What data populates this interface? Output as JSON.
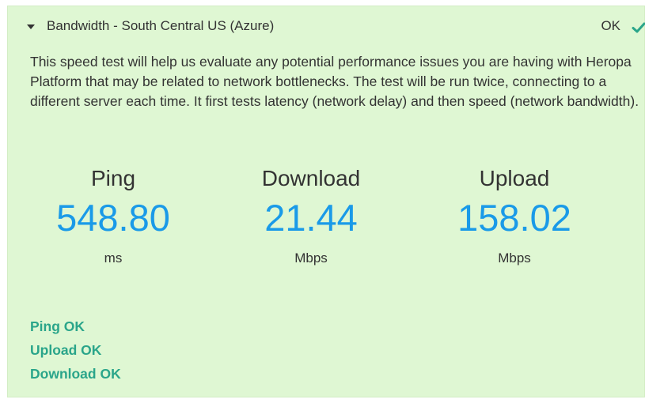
{
  "panel": {
    "title": "Bandwidth - South Central US (Azure)",
    "status": "OK",
    "caret_icon": "caret-down-icon",
    "status_icon": "checkmark-icon",
    "description": "This speed test will help us evaluate any potential performance issues you are having with Heropa Platform that may be related to network bottlenecks. The test will be run twice, connecting to a different server each time. It first tests latency (network delay) and then speed (network bandwidth)."
  },
  "metrics": [
    {
      "label": "Ping",
      "value": "548.80",
      "unit": "ms"
    },
    {
      "label": "Download",
      "value": "21.44",
      "unit": "Mbps"
    },
    {
      "label": "Upload",
      "value": "158.02",
      "unit": "Mbps"
    }
  ],
  "results": [
    "Ping OK",
    "Upload OK",
    "Download OK"
  ],
  "colors": {
    "panel_background": "#dff7d3",
    "value_color": "#1a9ae8",
    "result_color": "#2aa58a",
    "check_color": "#2aa58a",
    "text_color": "#333333"
  }
}
